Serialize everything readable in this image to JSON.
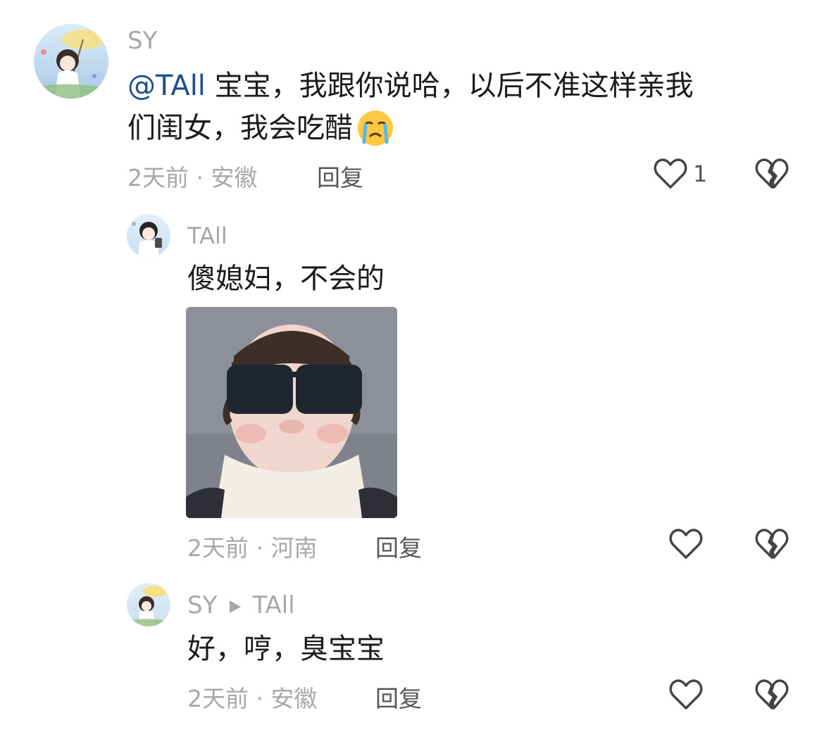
{
  "comments": [
    {
      "username": "SY",
      "mention": "@TAll",
      "text_line1": " 宝宝，我跟你说哈，以后不准这样亲我",
      "text_line2": "们闺女，我会吃醋",
      "meta": "2天前 · 安徽",
      "reply_label": "回复",
      "like_count": "1",
      "emoji_icon": "crying-face-icon"
    },
    {
      "username": "TAll",
      "text": "傻媳妇，不会的",
      "meta": "2天前 · 河南",
      "reply_label": "回复",
      "image_desc_icon": "photo-thumbnail"
    },
    {
      "username": "SY",
      "reply_to": "TAll",
      "text": "好，哼，臭宝宝",
      "meta": "2天前 · 安徽",
      "reply_label": "回复"
    }
  ],
  "colors": {
    "username": "#a7a7a7",
    "mention": "#1d4f8c",
    "text": "#1a1a1a",
    "meta": "#a8a8a8"
  }
}
